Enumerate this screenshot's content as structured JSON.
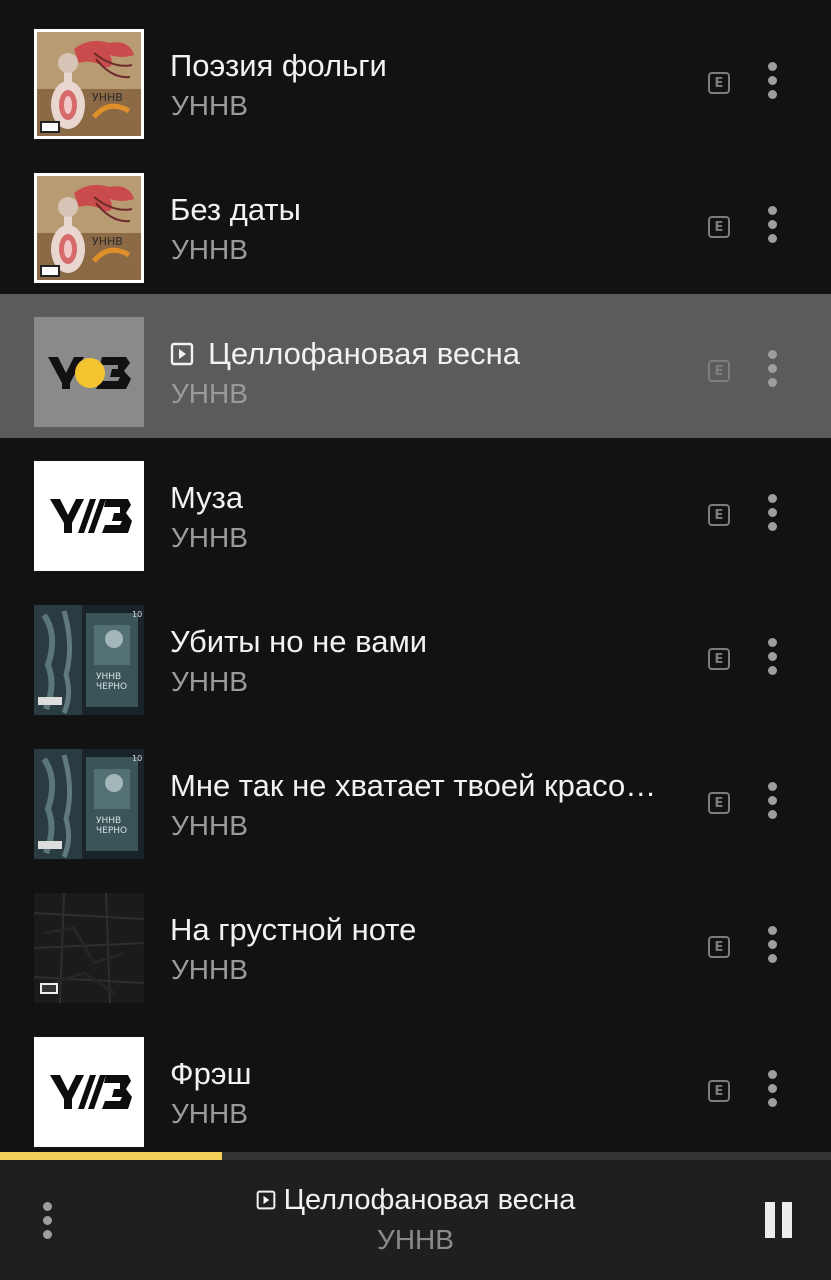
{
  "tracks": [
    {
      "title": "Поэзия фольги",
      "artist": "УННВ",
      "cover": "collage-art",
      "explicit": "E",
      "active": false
    },
    {
      "title": "Без даты",
      "artist": "УННВ",
      "cover": "collage-art",
      "explicit": "E",
      "active": false
    },
    {
      "title": "Целлофановая весна",
      "artist": "УННВ",
      "cover": "logo-dot",
      "explicit": "E",
      "active": true
    },
    {
      "title": "Муза",
      "artist": "УННВ",
      "cover": "logo-white",
      "explicit": "E",
      "active": false
    },
    {
      "title": "Убиты но не вами",
      "artist": "УННВ",
      "cover": "xray-dark",
      "explicit": "E",
      "active": false
    },
    {
      "title": "Мне так не хватает твоей красо…",
      "artist": "УННВ",
      "cover": "xray-dark",
      "explicit": "E",
      "active": false
    },
    {
      "title": "На грустной ноте",
      "artist": "УННВ",
      "cover": "dark-texture",
      "explicit": "E",
      "active": false
    },
    {
      "title": "Фрэш",
      "artist": "УННВ",
      "cover": "logo-white",
      "explicit": "E",
      "active": false
    }
  ],
  "player": {
    "title": "Целлофановая весна",
    "artist": "УННВ",
    "progress": 0.267
  },
  "colors": {
    "accent": "#f4cf5a",
    "background": "#121212",
    "active_row": "#5b5b5b",
    "player_bg": "#1f1f1f"
  },
  "icons": {
    "now_playing": "now-playing-icon",
    "explicit": "explicit-icon",
    "more": "more-vertical-icon",
    "pause": "pause-icon"
  }
}
